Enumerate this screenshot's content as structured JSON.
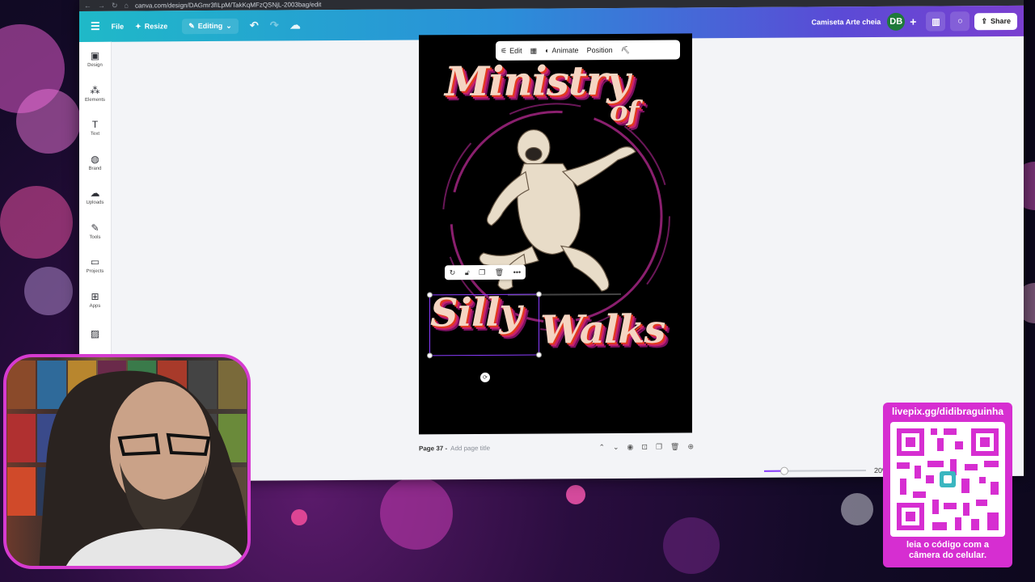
{
  "browser": {
    "url": "canva.com/design/DAGmr3fILpM/TakKqMFzQSNjL-2003bag/edit"
  },
  "topbar": {
    "file_label": "File",
    "resize_label": "Resize",
    "editing_label": "Editing",
    "doc_title": "Camiseta Arte cheia",
    "avatar_initials": "DB",
    "share_label": "Share"
  },
  "sidebar": {
    "items": [
      {
        "label": "Design",
        "icon": "layout-icon"
      },
      {
        "label": "Elements",
        "icon": "shapes-icon"
      },
      {
        "label": "Text",
        "icon": "text-icon"
      },
      {
        "label": "Brand",
        "icon": "brand-icon"
      },
      {
        "label": "Uploads",
        "icon": "cloud-upload-icon"
      },
      {
        "label": "Tools",
        "icon": "pen-icon"
      },
      {
        "label": "Projects",
        "icon": "folder-icon"
      },
      {
        "label": "Apps",
        "icon": "apps-icon"
      }
    ]
  },
  "context_toolbar": {
    "edit_label": "Edit",
    "animate_label": "Animate",
    "position_label": "Position"
  },
  "artwork": {
    "line1": "Ministry",
    "line2": "of",
    "line3": "Silly",
    "line4": "Walks"
  },
  "page_footer": {
    "page_label": "Page 37 -",
    "add_title": "Add page title"
  },
  "zoom": {
    "value_label": "20%",
    "level_fraction": 0.2
  },
  "overlay": {
    "qr_top": "livepix.gg/didibraguinha",
    "qr_bottom_line1": "leia o código com a",
    "qr_bottom_line2": "câmera do celular."
  },
  "colors": {
    "brand_gradient_start": "#1fb9c8",
    "brand_gradient_end": "#7a3fd0",
    "selection": "#8b3dff",
    "stream_accent": "#d62ed1"
  }
}
